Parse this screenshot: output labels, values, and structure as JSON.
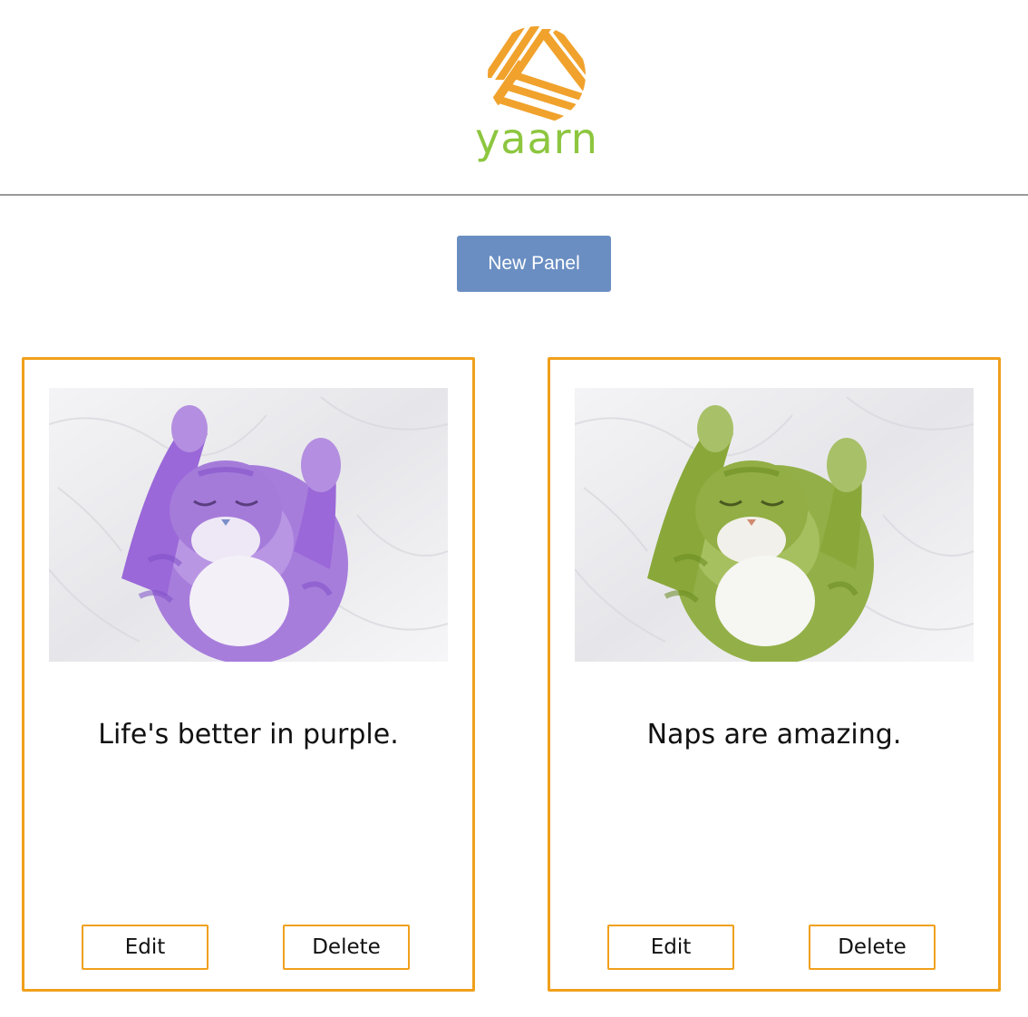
{
  "header": {
    "logo_text": "yaarn",
    "brand_colors": {
      "ball": "#f0a22c",
      "text": "#8dc63f"
    }
  },
  "toolbar": {
    "new_panel_label": "New Panel",
    "button_color": "#6a8ec2"
  },
  "panels": [
    {
      "image": "sleeping-kitten-purple",
      "tint": "#9a68d8",
      "caption": "Life's better in purple.",
      "edit_label": "Edit",
      "delete_label": "Delete"
    },
    {
      "image": "sleeping-kitten-green",
      "tint": "#8aa83a",
      "caption": "Naps are amazing.",
      "edit_label": "Edit",
      "delete_label": "Delete"
    }
  ],
  "panel_border_color": "#f0a01c"
}
